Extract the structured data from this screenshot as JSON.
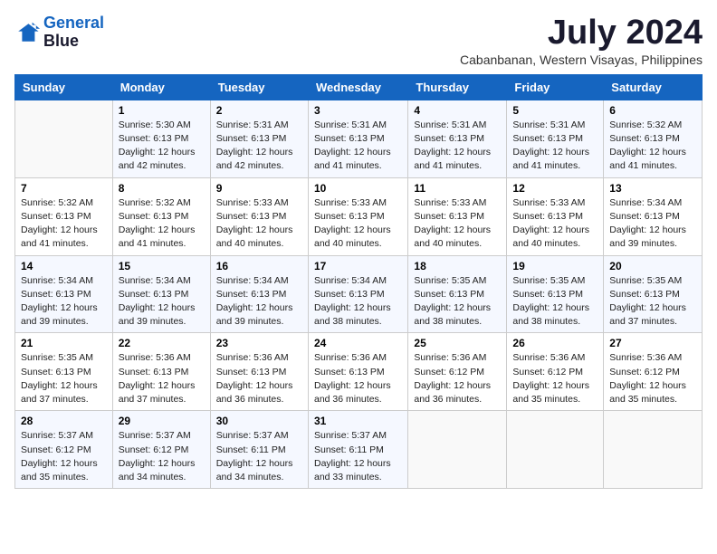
{
  "logo": {
    "line1": "General",
    "line2": "Blue"
  },
  "title": "July 2024",
  "subtitle": "Cabanbanan, Western Visayas, Philippines",
  "days_header": [
    "Sunday",
    "Monday",
    "Tuesday",
    "Wednesday",
    "Thursday",
    "Friday",
    "Saturday"
  ],
  "weeks": [
    [
      {
        "day": "",
        "info": ""
      },
      {
        "day": "1",
        "info": "Sunrise: 5:30 AM\nSunset: 6:13 PM\nDaylight: 12 hours\nand 42 minutes."
      },
      {
        "day": "2",
        "info": "Sunrise: 5:31 AM\nSunset: 6:13 PM\nDaylight: 12 hours\nand 42 minutes."
      },
      {
        "day": "3",
        "info": "Sunrise: 5:31 AM\nSunset: 6:13 PM\nDaylight: 12 hours\nand 41 minutes."
      },
      {
        "day": "4",
        "info": "Sunrise: 5:31 AM\nSunset: 6:13 PM\nDaylight: 12 hours\nand 41 minutes."
      },
      {
        "day": "5",
        "info": "Sunrise: 5:31 AM\nSunset: 6:13 PM\nDaylight: 12 hours\nand 41 minutes."
      },
      {
        "day": "6",
        "info": "Sunrise: 5:32 AM\nSunset: 6:13 PM\nDaylight: 12 hours\nand 41 minutes."
      }
    ],
    [
      {
        "day": "7",
        "info": "Sunrise: 5:32 AM\nSunset: 6:13 PM\nDaylight: 12 hours\nand 41 minutes."
      },
      {
        "day": "8",
        "info": "Sunrise: 5:32 AM\nSunset: 6:13 PM\nDaylight: 12 hours\nand 41 minutes."
      },
      {
        "day": "9",
        "info": "Sunrise: 5:33 AM\nSunset: 6:13 PM\nDaylight: 12 hours\nand 40 minutes."
      },
      {
        "day": "10",
        "info": "Sunrise: 5:33 AM\nSunset: 6:13 PM\nDaylight: 12 hours\nand 40 minutes."
      },
      {
        "day": "11",
        "info": "Sunrise: 5:33 AM\nSunset: 6:13 PM\nDaylight: 12 hours\nand 40 minutes."
      },
      {
        "day": "12",
        "info": "Sunrise: 5:33 AM\nSunset: 6:13 PM\nDaylight: 12 hours\nand 40 minutes."
      },
      {
        "day": "13",
        "info": "Sunrise: 5:34 AM\nSunset: 6:13 PM\nDaylight: 12 hours\nand 39 minutes."
      }
    ],
    [
      {
        "day": "14",
        "info": "Sunrise: 5:34 AM\nSunset: 6:13 PM\nDaylight: 12 hours\nand 39 minutes."
      },
      {
        "day": "15",
        "info": "Sunrise: 5:34 AM\nSunset: 6:13 PM\nDaylight: 12 hours\nand 39 minutes."
      },
      {
        "day": "16",
        "info": "Sunrise: 5:34 AM\nSunset: 6:13 PM\nDaylight: 12 hours\nand 39 minutes."
      },
      {
        "day": "17",
        "info": "Sunrise: 5:34 AM\nSunset: 6:13 PM\nDaylight: 12 hours\nand 38 minutes."
      },
      {
        "day": "18",
        "info": "Sunrise: 5:35 AM\nSunset: 6:13 PM\nDaylight: 12 hours\nand 38 minutes."
      },
      {
        "day": "19",
        "info": "Sunrise: 5:35 AM\nSunset: 6:13 PM\nDaylight: 12 hours\nand 38 minutes."
      },
      {
        "day": "20",
        "info": "Sunrise: 5:35 AM\nSunset: 6:13 PM\nDaylight: 12 hours\nand 37 minutes."
      }
    ],
    [
      {
        "day": "21",
        "info": "Sunrise: 5:35 AM\nSunset: 6:13 PM\nDaylight: 12 hours\nand 37 minutes."
      },
      {
        "day": "22",
        "info": "Sunrise: 5:36 AM\nSunset: 6:13 PM\nDaylight: 12 hours\nand 37 minutes."
      },
      {
        "day": "23",
        "info": "Sunrise: 5:36 AM\nSunset: 6:13 PM\nDaylight: 12 hours\nand 36 minutes."
      },
      {
        "day": "24",
        "info": "Sunrise: 5:36 AM\nSunset: 6:13 PM\nDaylight: 12 hours\nand 36 minutes."
      },
      {
        "day": "25",
        "info": "Sunrise: 5:36 AM\nSunset: 6:12 PM\nDaylight: 12 hours\nand 36 minutes."
      },
      {
        "day": "26",
        "info": "Sunrise: 5:36 AM\nSunset: 6:12 PM\nDaylight: 12 hours\nand 35 minutes."
      },
      {
        "day": "27",
        "info": "Sunrise: 5:36 AM\nSunset: 6:12 PM\nDaylight: 12 hours\nand 35 minutes."
      }
    ],
    [
      {
        "day": "28",
        "info": "Sunrise: 5:37 AM\nSunset: 6:12 PM\nDaylight: 12 hours\nand 35 minutes."
      },
      {
        "day": "29",
        "info": "Sunrise: 5:37 AM\nSunset: 6:12 PM\nDaylight: 12 hours\nand 34 minutes."
      },
      {
        "day": "30",
        "info": "Sunrise: 5:37 AM\nSunset: 6:11 PM\nDaylight: 12 hours\nand 34 minutes."
      },
      {
        "day": "31",
        "info": "Sunrise: 5:37 AM\nSunset: 6:11 PM\nDaylight: 12 hours\nand 33 minutes."
      },
      {
        "day": "",
        "info": ""
      },
      {
        "day": "",
        "info": ""
      },
      {
        "day": "",
        "info": ""
      }
    ]
  ]
}
